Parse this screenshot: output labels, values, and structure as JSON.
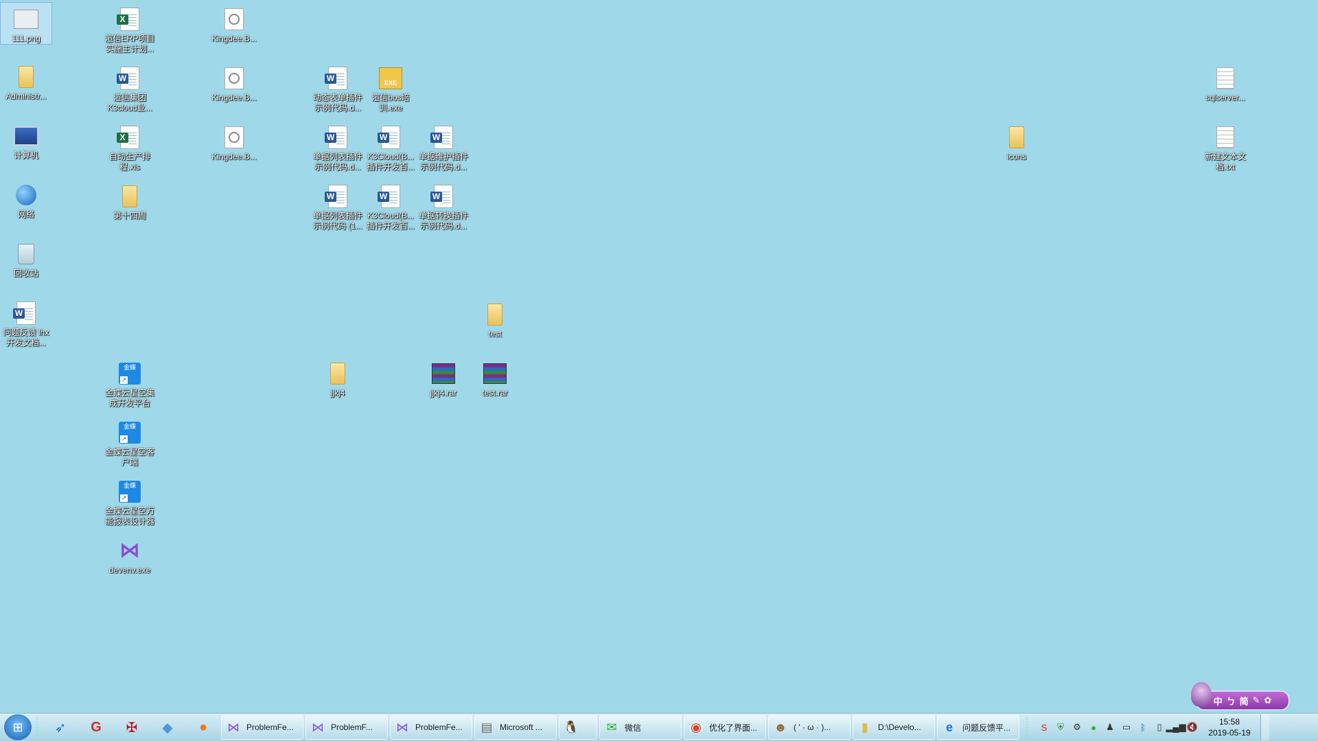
{
  "colors": {
    "desktop": "#9fd9e9",
    "word_badge": "#2b5797",
    "excel_badge": "#1e7145"
  },
  "icons": {
    "img111": "111.png",
    "excel_erp": "渲信ERP项目\n实施主计划...",
    "kingdee1": "Kingdee.B...",
    "admin": "Administr...",
    "word_k3cloud": "渲信集团\nK3cloud业...",
    "kingdee2": "Kingdee.B...",
    "word_dyn": "动态表单插件\n示例代码.d...",
    "exe_bos": "渲信bos培\n训.exe",
    "sqlserver": "sqlserver...",
    "computer": "计算机",
    "excel_auto": "自动生产排\n程.xls",
    "kingdee3": "Kingdee.B...",
    "word_list1": "单据列表插件\n示例代码.d...",
    "word_k3c1": "K3Cloud(B...\n插件开发百...",
    "word_maint": "单据维护插件\n示例代码.d...",
    "icons_folder": "icons",
    "newtxt": "新建文本文\n档.txt",
    "network": "网络",
    "folder_14": "第十四周",
    "word_list2": "单据列表插件\n示例代码 (1...",
    "word_k3c2": "K3Cloud(B...\n插件开发百...",
    "word_conv": "单据转换插件\n示例代码.d...",
    "recycle": "回收站",
    "test_folder": "test",
    "word_feedback": "问题反馈 lhx\n开发文档...",
    "kd_integration": "金蝶云星空集\n成开发平台",
    "jjkj4_folder": "jjkj4",
    "jjkj4_rar": "jjkj4.rar",
    "test_rar": "test.rar",
    "kd_client": "金蝶云星空客\n户端",
    "kd_report": "金蝶云星空万\n能报表设计器",
    "devenv": "devenv.exe"
  },
  "ime": {
    "items": [
      "中",
      "ㄅ",
      "简",
      "✎",
      "✿"
    ]
  },
  "taskbar": {
    "tasks": [
      {
        "label": "ProblemFe...",
        "icon": "⋈"
      },
      {
        "label": "ProblemF...",
        "icon": "⋈"
      },
      {
        "label": "ProblemFe...",
        "icon": "⋈"
      },
      {
        "label": "Microsoft ...",
        "icon": "▤"
      },
      {
        "label": "",
        "icon": "🐧"
      },
      {
        "label": "微信",
        "icon": "✉"
      },
      {
        "label": "优化了界面...",
        "icon": "◉"
      },
      {
        "label": "( ' · ω · )...",
        "icon": "☻"
      },
      {
        "label": "D:\\Develo...",
        "icon": "▮"
      },
      {
        "label": "问题反馈平...",
        "icon": "e"
      }
    ],
    "clock": {
      "time": "15:58",
      "date": "2019-05-19"
    }
  }
}
